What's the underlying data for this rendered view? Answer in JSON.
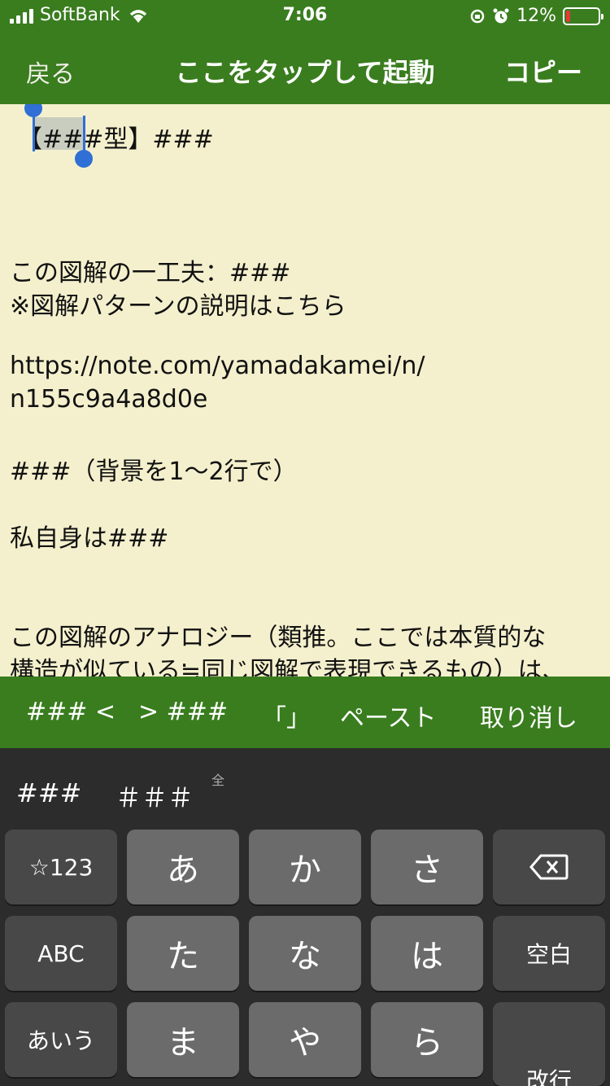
{
  "status_bar": {
    "carrier": "SoftBank",
    "time": "7:06",
    "battery_percent": "12%",
    "battery_level": 0.12,
    "battery_color": "#e53935"
  },
  "nav": {
    "back_label": "戻る",
    "title": "ここをタップして起動",
    "copy_label": "コピー"
  },
  "editor": {
    "lines": [
      "【###型】###",
      "この図解の一工夫：###",
      "※図解パターンの説明はこちら",
      "https://note.com/yamadakamei/n/",
      "n155c9a4a8d0e",
      "###（背景を1〜2行で）",
      "私自身は###",
      "この図解のアナロジー（類推。ここでは本質的な",
      "構造が似ている≒同じ図解で表現できるもの）は、"
    ]
  },
  "toolbar": {
    "items": [
      "### <",
      "> ###",
      "「」",
      "ペースト",
      "取り消し"
    ]
  },
  "keyboard": {
    "candidates": [
      "###",
      "＃＃＃"
    ],
    "candidate_note": "全",
    "keys": {
      "symbols": "☆123",
      "a": "あ",
      "ka": "か",
      "sa": "さ",
      "abc": "ABC",
      "ta": "た",
      "na": "な",
      "ha": "は",
      "space": "空白",
      "aiu": "あいう",
      "ma": "ま",
      "ya": "や",
      "ra": "ら",
      "enter": "改行"
    }
  },
  "colors": {
    "bar_green": "#3a7d1f",
    "editor_bg": "#f4f0cd",
    "selection_blue": "#2f6fd6"
  }
}
